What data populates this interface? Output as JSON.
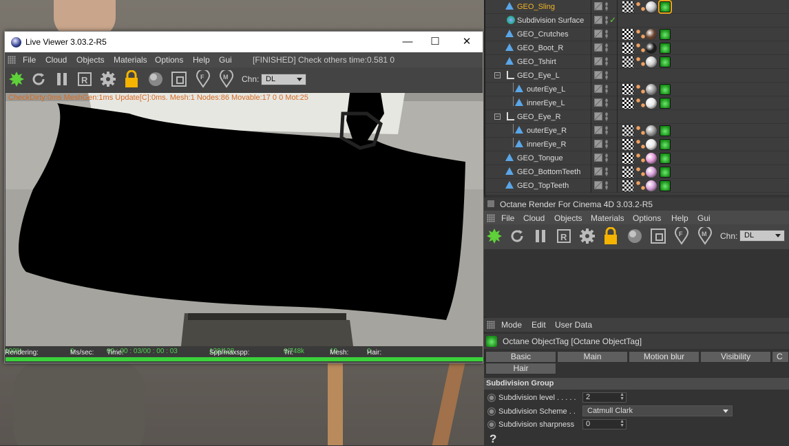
{
  "live_viewer": {
    "title": "Live Viewer 3.03.2-R5",
    "window_controls": {
      "minimize": "—",
      "maximize": "☐",
      "close": "✕"
    },
    "menu": [
      "File",
      "Cloud",
      "Objects",
      "Materials",
      "Options",
      "Help",
      "Gui"
    ],
    "status_message": "[FINISHED] Check others time:0.581  0",
    "channel_label": "Chn:",
    "channel_value": "DL",
    "overlay_text": "CheckDirty:0ms MeshGen:1ms  Update[C]:0ms. Mesh:1 Nodes:86 Movable:17  0 0 Mot:25",
    "status_bar": {
      "rendering_label": "Rendering:",
      "rendering_value": "100%",
      "mssec_label": "Ms/sec:",
      "mssec_value": "0",
      "time_label": "Time:",
      "time_value": "00 : 00 : 03/00 : 00 : 03",
      "spp_label": "Spp/maxspp:",
      "spp_value": "128/128",
      "tri_label": "Tri:",
      "tri_value": "0/748k",
      "mesh_label": "Mesh:",
      "mesh_value": "19",
      "hair_label": "Hair:",
      "hair_value": "0"
    },
    "progress": 1.0
  },
  "object_manager": {
    "rows": [
      {
        "name": "GEO_Sling",
        "selected": true
      },
      {
        "name": "Subdivision Surface"
      },
      {
        "name": "GEO_Crutches"
      },
      {
        "name": "GEO_Boot_R"
      },
      {
        "name": "GEO_Tshirt"
      },
      {
        "name": "GEO_Eye_L"
      },
      {
        "name": "outerEye_L"
      },
      {
        "name": "innerEye_L"
      },
      {
        "name": "GEO_Eye_R"
      },
      {
        "name": "outerEye_R"
      },
      {
        "name": "innerEye_R"
      },
      {
        "name": "GEO_Tongue"
      },
      {
        "name": "GEO_BottomTeeth"
      },
      {
        "name": "GEO_TopTeeth"
      }
    ],
    "check_mark": "✓",
    "name_selected_color": "#f0b429"
  },
  "octane_panel": {
    "title": "Octane Render For Cinema 4D 3.03.2-R5",
    "menu": [
      "File",
      "Cloud",
      "Objects",
      "Materials",
      "Options",
      "Help",
      "Gui"
    ],
    "channel_label": "Chn:",
    "channel_value": "DL"
  },
  "attribute_manager": {
    "menu": [
      "Mode",
      "Edit",
      "User Data"
    ],
    "title": "Octane ObjectTag [Octane ObjectTag]",
    "tabs": [
      "Basic",
      "Main",
      "Motion blur",
      "Visibility",
      "C"
    ],
    "tabs_row2": [
      "Hair"
    ],
    "group": "Subdivision Group",
    "params": [
      {
        "label": "Subdivision level . . . . .",
        "value": "2"
      },
      {
        "label": "Subdivision Scheme . .",
        "value": "Catmull Clark"
      },
      {
        "label": "Subdivision sharpness",
        "value": "0"
      }
    ],
    "help_icon": "?"
  },
  "colors": {
    "accent_green": "#3ad13a",
    "selected_orange": "#f0b429",
    "panel_bg": "#3d3d3d"
  }
}
